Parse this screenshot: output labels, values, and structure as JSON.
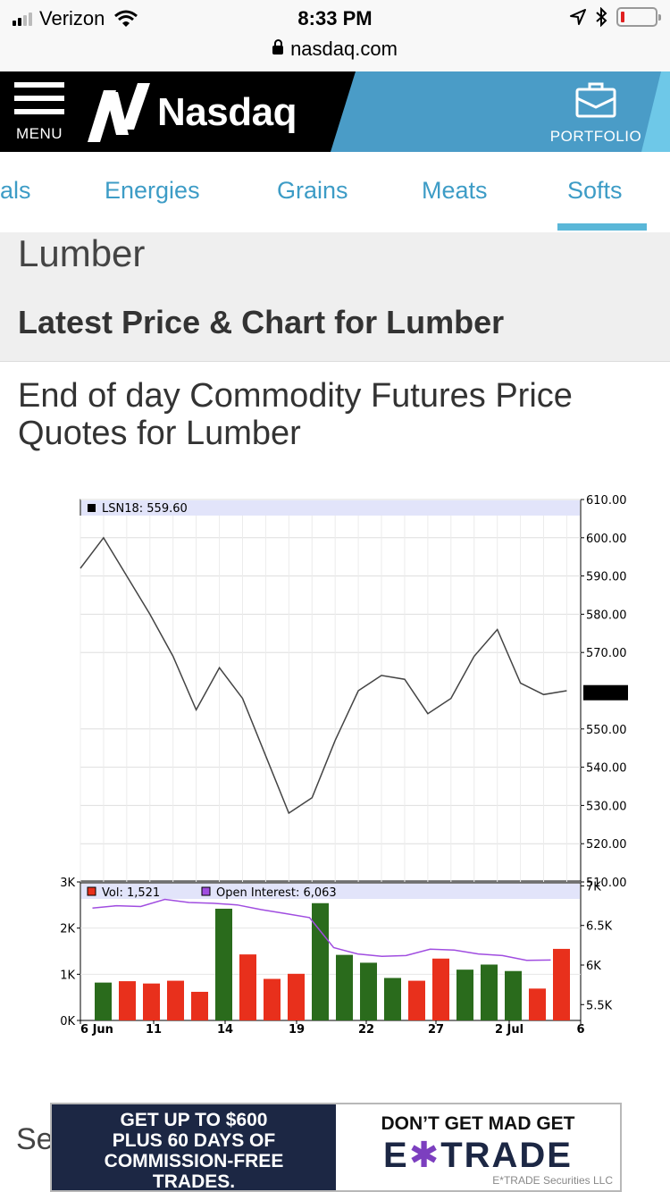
{
  "status_bar": {
    "carrier": "Verizon",
    "time": "8:33 PM"
  },
  "browser": {
    "url": "nasdaq.com"
  },
  "header": {
    "menu_label": "MENU",
    "logo_text": "Nasdaq",
    "portfolio_label": "PORTFOLIO",
    "colors": {
      "header_bg": "#000000",
      "portfolio_bg": "#4a9cc7",
      "accent": "#6ec8e8"
    }
  },
  "tabs": {
    "items": [
      {
        "label": "als"
      },
      {
        "label": "Energies"
      },
      {
        "label": "Grains"
      },
      {
        "label": "Meats"
      },
      {
        "label": "Softs",
        "active": true
      }
    ],
    "color": "#3d9cc6"
  },
  "page": {
    "title": "Lumber",
    "subtitle": "Latest Price & Chart for Lumber",
    "description": "End of day Commodity Futures Price Quotes for Lumber",
    "partial_text": "Se"
  },
  "chart_data": {
    "type": "line",
    "legend": "LSN18: 559.60",
    "last_value_label": "559.60",
    "x_tick_labels": [
      "6 Jun",
      "11",
      "14",
      "19",
      "22",
      "27",
      "2 Jul",
      "6"
    ],
    "price": {
      "ylim": [
        510,
        610
      ],
      "y_ticks": [
        "610.00",
        "600.00",
        "590.00",
        "580.00",
        "570.00",
        "559.60",
        "550.00",
        "540.00",
        "530.00",
        "520.00",
        "510.00"
      ],
      "values": [
        592,
        600,
        590,
        580,
        569,
        555,
        566,
        558,
        543,
        528,
        532,
        547,
        560,
        564,
        563,
        554,
        558,
        569,
        576,
        562,
        559,
        560
      ]
    },
    "volume": {
      "legend": "Vol: 1,521",
      "ylim": [
        0,
        3000
      ],
      "y_ticks": [
        "3K",
        "2K",
        "1K",
        "0K"
      ],
      "values": [
        820,
        850,
        800,
        860,
        620,
        2420,
        1430,
        900,
        1010,
        2540,
        1420,
        1250,
        920,
        860,
        1340,
        1100,
        1210,
        1070,
        690,
        1550
      ],
      "colors": [
        "green",
        "red",
        "red",
        "red",
        "red",
        "green",
        "red",
        "red",
        "red",
        "green",
        "green",
        "green",
        "green",
        "red",
        "red",
        "green",
        "green",
        "green",
        "red",
        "red"
      ]
    },
    "open_interest": {
      "legend": "Open Interest: 6,063",
      "ylim": [
        5300,
        7050
      ],
      "y_ticks": [
        "7K",
        "6.5K",
        "6K",
        "5.5K"
      ],
      "values": [
        6720,
        6750,
        6740,
        6830,
        6790,
        6780,
        6760,
        6700,
        6650,
        6600,
        6220,
        6140,
        6110,
        6120,
        6200,
        6190,
        6140,
        6120,
        6060,
        6063
      ]
    },
    "series_colors": {
      "price_line": "#444444",
      "volume_up": "#2a6b1c",
      "volume_down": "#e8301c",
      "open_interest": "#a04de0"
    }
  },
  "ad": {
    "left_lines": [
      "GET UP TO $600",
      "PLUS 60 DAYS OF",
      "COMMISSION-FREE",
      "TRADES."
    ],
    "headline": "DON’T GET MAD GET",
    "brand_pre": "E",
    "brand_star": "✱",
    "brand_post": "TRADE",
    "small": "E*TRADE Securities LLC"
  }
}
